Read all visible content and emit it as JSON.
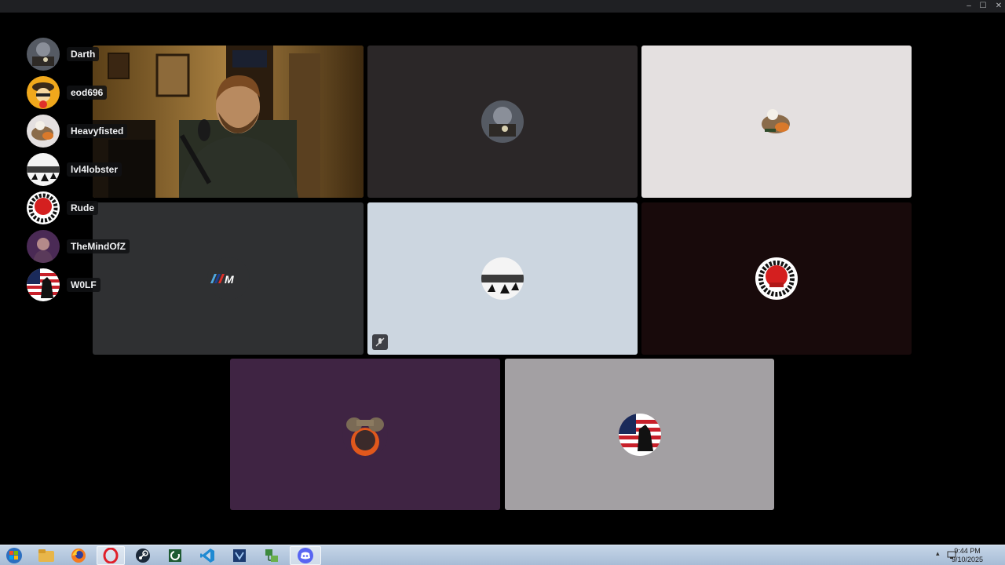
{
  "window": {
    "controls": {
      "minimize": "–",
      "maximize": "☐",
      "close": "✕"
    }
  },
  "voice_channel": {
    "members": [
      {
        "name": "Darth",
        "avatar": "darth-avatar"
      },
      {
        "name": "eod696",
        "avatar": "eod696-avatar"
      },
      {
        "name": "Heavyfisted",
        "avatar": "heavyfisted-avatar"
      },
      {
        "name": "lvl4lobster",
        "avatar": "lvl4lobster-avatar"
      },
      {
        "name": "Rude",
        "avatar": "rude-avatar"
      },
      {
        "name": "TheMindOfZ",
        "avatar": "themindofz-avatar"
      },
      {
        "name": "W0LF",
        "avatar": "w0lf-avatar"
      }
    ]
  },
  "tiles": {
    "webcam": {
      "type": "video",
      "muted": false
    },
    "tile_darth": {
      "bg": "#2b2728"
    },
    "tile_heavyfisted": {
      "bg": "#e4e0e0"
    },
    "tile_bmw": {
      "bg": "#2f3032"
    },
    "tile_lobster": {
      "bg": "#ccd6e0",
      "muted": true
    },
    "tile_rude": {
      "bg": "#180a0b"
    },
    "tile_mindofz": {
      "bg": "#3f2443"
    },
    "tile_wolf": {
      "bg": "#a3a0a3"
    }
  },
  "taskbar": {
    "apps": [
      "windows-start-icon",
      "file-explorer-icon",
      "firefox-icon",
      "opera-icon",
      "steam-icon",
      "cheat-engine-icon",
      "vscode-icon",
      "visual-studio-icon",
      "network-tool-icon",
      "discord-icon"
    ],
    "active": "discord-icon",
    "clock": {
      "time": "9:44 PM",
      "date": "9/10/2025"
    },
    "tray": {
      "show_hidden": "▴"
    }
  }
}
